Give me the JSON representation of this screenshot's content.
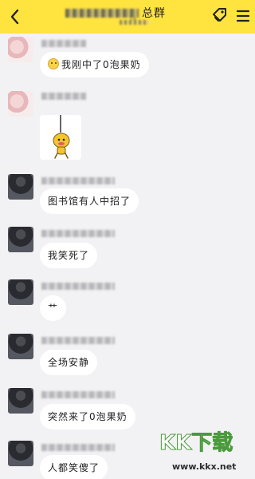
{
  "header": {
    "title_suffix": "总群",
    "subtitle": "14"
  },
  "messages": [
    {
      "text": "我刚中了0泡果奶",
      "has_emoji": true
    },
    {
      "sticker": "monkey-sticker"
    },
    {
      "text": "图书馆有人中招了"
    },
    {
      "text": "我笑死了"
    },
    {
      "text": "艹"
    },
    {
      "text": "全场安静"
    },
    {
      "text": "突然来了0泡果奶"
    },
    {
      "text": "人都笑傻了"
    }
  ],
  "watermark": {
    "text": "KK下载",
    "url": "www.kkx.net"
  },
  "colors": {
    "header_bg": "#ffe33f",
    "chat_bg": "#f2f2f4",
    "bubble_bg": "#ffffff"
  }
}
